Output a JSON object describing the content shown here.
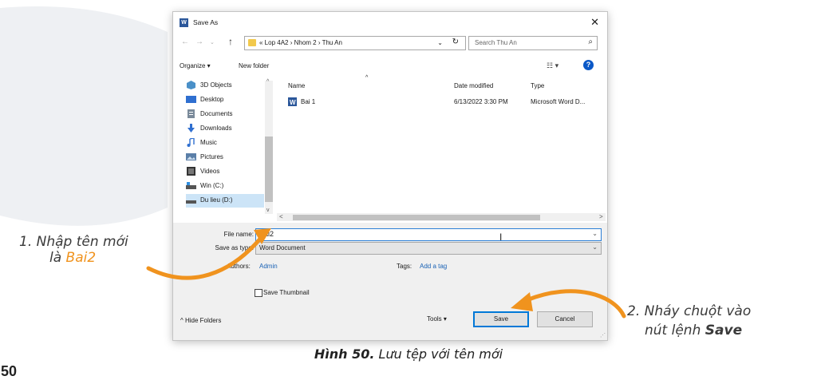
{
  "dialog": {
    "title": "Save As",
    "app_icon_letter": "W",
    "close_glyph": "✕",
    "nav": {
      "back": "←",
      "forward": "→",
      "up": "↑",
      "address_path": "« Lop 4A2 › Nhom 2 › Thu An",
      "address_dropdown": "⌄",
      "refresh": "↻",
      "search_placeholder": "Search Thu An",
      "search_icon": "⌕"
    },
    "commands": {
      "organize": "Organize ▾",
      "new_folder": "New folder",
      "view": "☷ ▾",
      "help": "?"
    },
    "nav_pane": [
      {
        "label": "3D Objects",
        "icon": "cube-icon"
      },
      {
        "label": "Desktop",
        "icon": "desktop-icon"
      },
      {
        "label": "Documents",
        "icon": "documents-icon"
      },
      {
        "label": "Downloads",
        "icon": "download-icon"
      },
      {
        "label": "Music",
        "icon": "music-icon"
      },
      {
        "label": "Pictures",
        "icon": "pictures-icon"
      },
      {
        "label": "Videos",
        "icon": "videos-icon"
      },
      {
        "label": "Win (C:)",
        "icon": "drive-icon"
      },
      {
        "label": "Du lieu (D:)",
        "icon": "drive-icon"
      }
    ],
    "columns": {
      "name": "Name",
      "date": "Date modified",
      "type": "Type"
    },
    "files": [
      {
        "name": "Bai 1",
        "date": "6/13/2022 3:30 PM",
        "type": "Microsoft Word D..."
      }
    ],
    "form": {
      "file_name_label": "File name:",
      "file_name_value": "Bai2",
      "save_as_type_label": "Save as type:",
      "save_as_type_value": "Word Document",
      "authors_label": "Authors:",
      "authors_value": "Admin",
      "tags_label": "Tags:",
      "tags_value": "Add a tag",
      "thumbnail_label": "Save Thumbnail"
    },
    "footer": {
      "hide_folders": "^ Hide Folders",
      "tools": "Tools ▾",
      "save": "Save",
      "cancel": "Cancel"
    }
  },
  "annotations": {
    "step1_line1": "1. Nhập tên mới",
    "step1_prefix": "là ",
    "step1_highlight": "Bai2",
    "step2_line1": "2. Nháy chuột vào",
    "step2_prefix": "nút lệnh ",
    "step2_bold": "Save"
  },
  "caption": {
    "label": "Hình 50.",
    "text": " Lưu tệp với tên mới"
  },
  "page_number": "50",
  "colors": {
    "accent_orange": "#f0931e",
    "selection_blue": "#cce4f7",
    "link_blue": "#1a62b5"
  }
}
